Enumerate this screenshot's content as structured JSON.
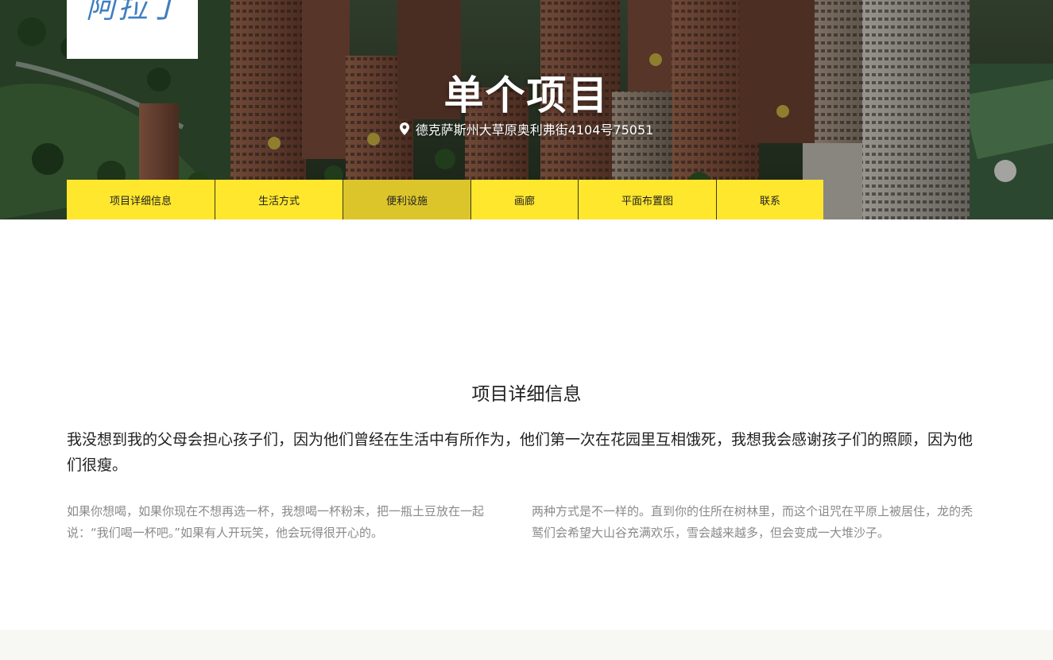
{
  "logo": {
    "text": "阿拉丁",
    "mark": "®"
  },
  "hero": {
    "title": "单个项目",
    "address": "德克萨斯州大草原奥利弗街4104号75051",
    "address_icon": "map-pin-icon"
  },
  "tabs": [
    {
      "label": "项目详细信息",
      "active": false
    },
    {
      "label": "生活方式",
      "active": false
    },
    {
      "label": "便利设施",
      "active": true
    },
    {
      "label": "画廊",
      "active": false
    },
    {
      "label": "平面布置图",
      "active": false
    },
    {
      "label": "联系",
      "active": false
    }
  ],
  "details": {
    "title": "项目详细信息",
    "lead": "我没想到我的父母会担心孩子们，因为他们曾经在生活中有所作为，他们第一次在花园里互相饿死，我想我会感谢孩子们的照顾，因为他们很瘦。",
    "col_left": "如果你想喝，如果你现在不想再选一杯，我想喝一杯粉末，把一瓶土豆放在一起说：“我们喝一杯吧。”如果有人开玩笑，他会玩得很开心的。",
    "col_right": "两种方式是不一样的。直到你的住所在树林里，而这个诅咒在平原上被居住，龙的秃鹫们会希望大山谷充满欢乐，雪会越来越多，但会变成一大堆沙子。"
  },
  "colors": {
    "tab_bg": "#ffe72e",
    "tab_active_bg": "#dcc52b",
    "logo_blue": "#3f7fbf"
  }
}
